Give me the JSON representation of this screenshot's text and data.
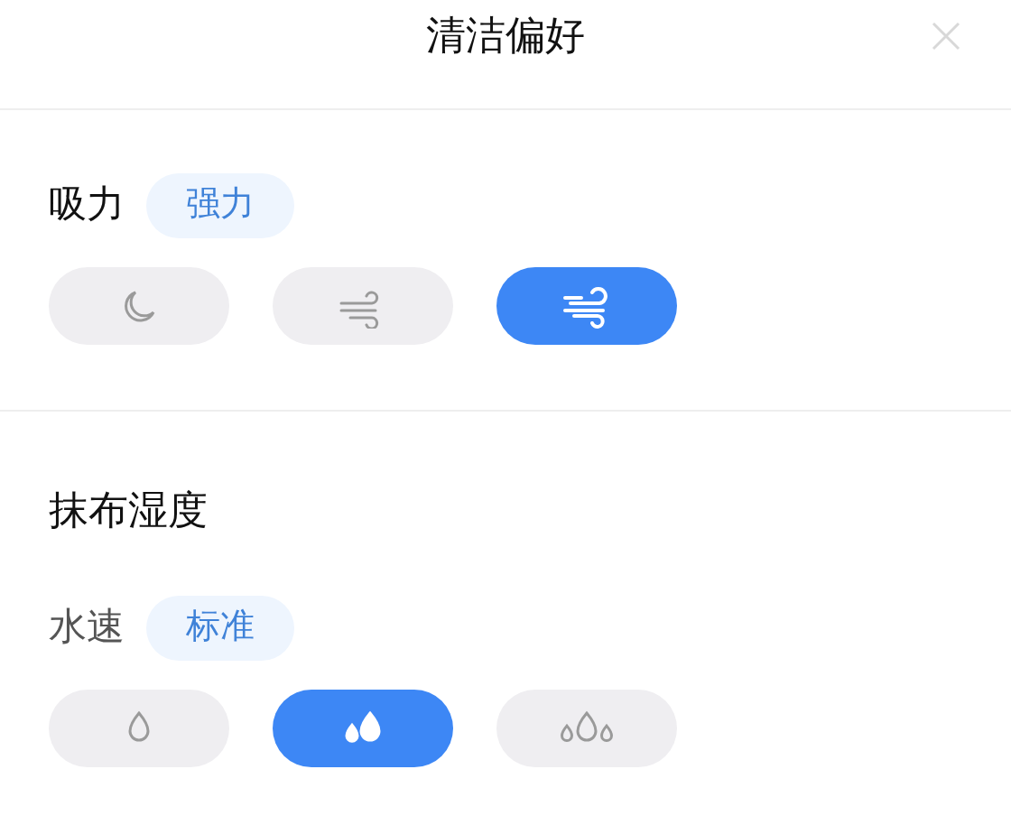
{
  "title": "清洁偏好",
  "sections": [
    {
      "label": "吸力",
      "value": "强力",
      "options": [
        {
          "kind": "moon",
          "selected": false
        },
        {
          "kind": "wind-light",
          "selected": false
        },
        {
          "kind": "wind-strong",
          "selected": true
        }
      ]
    },
    {
      "heading": "抹布湿度",
      "label": "水速",
      "value": "标准",
      "options": [
        {
          "kind": "drop-one",
          "selected": false
        },
        {
          "kind": "drop-two",
          "selected": true
        },
        {
          "kind": "drop-three",
          "selected": false
        }
      ]
    }
  ]
}
